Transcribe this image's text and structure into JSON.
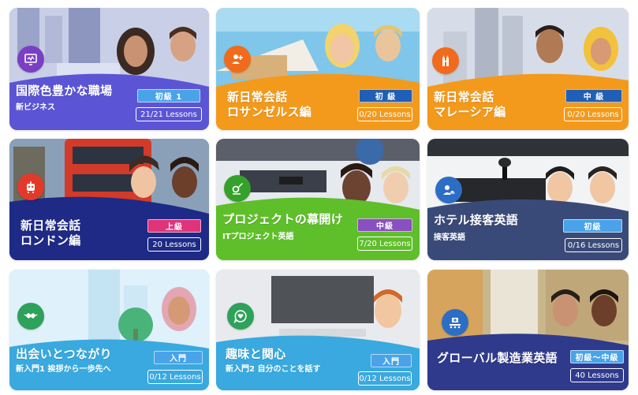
{
  "cards": [
    {
      "title": "国際色豊かな職場",
      "subtitle": "新ビジネス",
      "level": "初級 1",
      "lessons": "21/21 Lessons",
      "icon": "monitor-heart-icon",
      "color": "#5b55d6",
      "level_color": "#4aa3e8"
    },
    {
      "title": "新日常会話\nロサンゼルス編",
      "subtitle": "",
      "level": "初 級",
      "lessons": "0/20 Lessons",
      "icon": "people-plus-icon",
      "color": "#f39a1c",
      "level_color": "#1f5fb8"
    },
    {
      "title": "新日常会話\nマレーシア編",
      "subtitle": "",
      "level": "中 級",
      "lessons": "0/20 Lessons",
      "icon": "twin-towers-icon",
      "color": "#f39a1c",
      "level_color": "#1f5fb8"
    },
    {
      "title": "新日常会話\nロンドン編",
      "subtitle": "",
      "level": "上級",
      "lessons": "20 Lessons",
      "icon": "robot-icon",
      "color": "#1e2a86",
      "level_color": "#e0337a"
    },
    {
      "title": "プロジェクトの幕開け",
      "subtitle": "ITプロジェクト英語",
      "level": "中級",
      "lessons": "7/20 Lessons",
      "icon": "settings-pen-icon",
      "color": "#5fbf2a",
      "level_color": "#8a4fc0"
    },
    {
      "title": "ホテル接客英語",
      "subtitle": "接客英語",
      "level": "初級",
      "lessons": "0/16 Lessons",
      "icon": "concierge-icon",
      "color": "#3a4a78",
      "level_color": "#4aa3e8"
    },
    {
      "title": "出会いとつながり",
      "subtitle": "新入門1 挨拶から一歩先へ",
      "level": "入門",
      "lessons": "0/12 Lessons",
      "icon": "handshake-icon",
      "color": "#39a9df",
      "level_color": "#4aa3e8"
    },
    {
      "title": "趣味と関心",
      "subtitle": "新入門2 自分のことを話す",
      "level": "入門",
      "lessons": "0/12 Lessons",
      "icon": "heart-chat-icon",
      "color": "#39a9df",
      "level_color": "#4aa3e8"
    },
    {
      "title": "グローバル製造業英語",
      "subtitle": "",
      "level": "初級〜中級",
      "lessons": "40 Lessons",
      "icon": "factory-icon",
      "color": "#2f3a8c",
      "level_color": "#4aa3e8"
    }
  ]
}
